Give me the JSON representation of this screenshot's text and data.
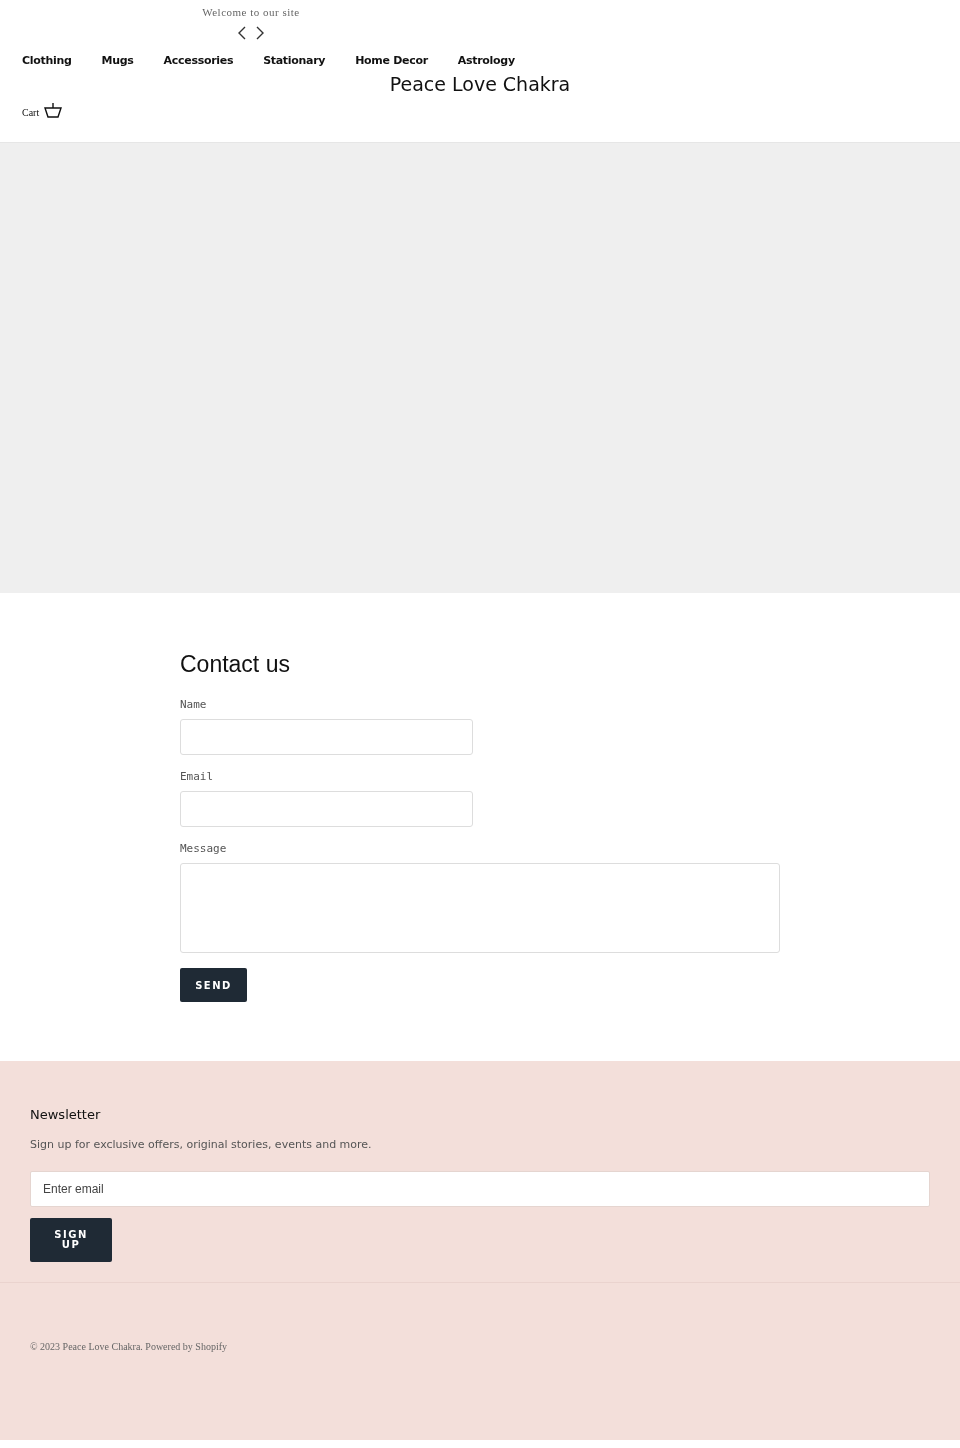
{
  "announcement": {
    "text": "Welcome to our site"
  },
  "nav": {
    "items": [
      {
        "label": "Clothing"
      },
      {
        "label": "Mugs"
      },
      {
        "label": "Accessories"
      },
      {
        "label": "Stationary"
      },
      {
        "label": "Home Decor"
      },
      {
        "label": "Astrology"
      }
    ]
  },
  "logo": "Peace Love Chakra",
  "cart": {
    "label": "Cart"
  },
  "contact": {
    "title": "Contact us",
    "fields": [
      {
        "label": "Name",
        "kind": "input"
      },
      {
        "label": "Email",
        "kind": "input"
      },
      {
        "label": "Message",
        "kind": "textarea"
      }
    ],
    "button": "SEND"
  },
  "newsletter": {
    "title": "Newsletter",
    "text": "Sign up for exclusive offers, original stories, events and more.",
    "placeholder": "Enter email",
    "button": "SIGN UP"
  },
  "footer": {
    "copyright": "© 2023 Peace Love Chakra. Powered by Shopify"
  }
}
